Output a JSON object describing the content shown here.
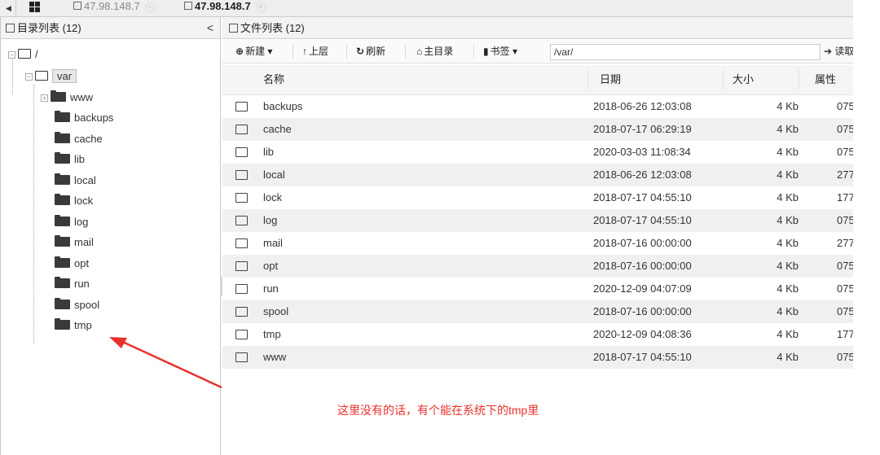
{
  "tabs": [
    {
      "label": "47.98.148.7",
      "active": false
    },
    {
      "label": "47.98.148.7",
      "active": true
    }
  ],
  "tab_close_glyph": "×",
  "left_panel": {
    "title": "目录列表 (12)",
    "collapse_glyph": "<",
    "root": "/",
    "current": "var",
    "children": [
      "www",
      "backups",
      "cache",
      "lib",
      "local",
      "lock",
      "log",
      "mail",
      "opt",
      "run",
      "spool",
      "tmp"
    ]
  },
  "right_panel": {
    "title": "文件列表 (12)",
    "toolbar": {
      "new_label": "新建",
      "up_label": "上层",
      "refresh_label": "刷新",
      "home_label": "主目录",
      "bookmark_label": "书签",
      "path_value": "/var/",
      "read_label": "读取"
    },
    "columns": [
      "名称",
      "日期",
      "大小",
      "属性"
    ],
    "rows": [
      {
        "name": "backups",
        "date": "2018-06-26 12:03:08",
        "size": "4 Kb",
        "attr": "075"
      },
      {
        "name": "cache",
        "date": "2018-07-17 06:29:19",
        "size": "4 Kb",
        "attr": "075"
      },
      {
        "name": "lib",
        "date": "2020-03-03 11:08:34",
        "size": "4 Kb",
        "attr": "075"
      },
      {
        "name": "local",
        "date": "2018-06-26 12:03:08",
        "size": "4 Kb",
        "attr": "277"
      },
      {
        "name": "lock",
        "date": "2018-07-17 04:55:10",
        "size": "4 Kb",
        "attr": "177"
      },
      {
        "name": "log",
        "date": "2018-07-17 04:55:10",
        "size": "4 Kb",
        "attr": "075"
      },
      {
        "name": "mail",
        "date": "2018-07-16 00:00:00",
        "size": "4 Kb",
        "attr": "277"
      },
      {
        "name": "opt",
        "date": "2018-07-16 00:00:00",
        "size": "4 Kb",
        "attr": "075"
      },
      {
        "name": "run",
        "date": "2020-12-09 04:07:09",
        "size": "4 Kb",
        "attr": "075"
      },
      {
        "name": "spool",
        "date": "2018-07-16 00:00:00",
        "size": "4 Kb",
        "attr": "075"
      },
      {
        "name": "tmp",
        "date": "2020-12-09 04:08:36",
        "size": "4 Kb",
        "attr": "177"
      },
      {
        "name": "www",
        "date": "2018-07-17 04:55:10",
        "size": "4 Kb",
        "attr": "075"
      }
    ]
  },
  "annotation": {
    "text": "这里没有的话，有个能在系统下的tmp里",
    "color": "#e8312b"
  },
  "colors": {
    "alt_row": "#f0f0f0",
    "header_bg": "#f3f3f3"
  }
}
